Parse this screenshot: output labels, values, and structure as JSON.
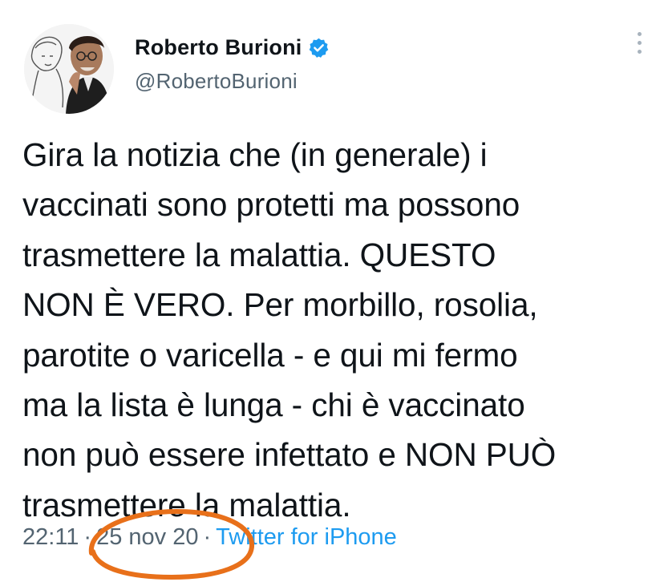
{
  "author": {
    "name": "Roberto Burioni",
    "handle": "@RobertoBurioni",
    "verified_icon": "verified-badge-icon",
    "verified_color": "#1d9bf0"
  },
  "tweet": {
    "text": "Gira la notizia che (in generale) i\nvaccinati sono protetti ma possono\ntrasmettere la malattia. QUESTO\nNON È VERO. Per morbillo, rosolia,\nparotite o varicella - e qui mi fermo\nma la lista è lunga - chi è vaccinato\nnon può essere infettato e NON PUÒ\ntrasmettere la malattia.",
    "time": "22:11",
    "date": "25 nov 20",
    "separator": "·",
    "source": "Twitter for iPhone"
  },
  "annotation": {
    "circle_color": "#e8701a"
  },
  "colors": {
    "text": "#0f1419",
    "secondary": "#536471",
    "link": "#1d9bf0"
  }
}
